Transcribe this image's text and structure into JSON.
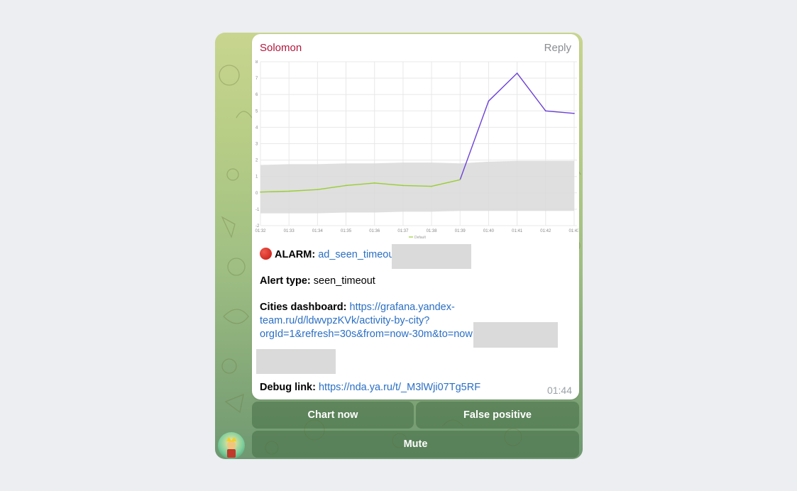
{
  "message": {
    "sender": "Solomon",
    "reply_label": "Reply",
    "alarm_label": "ALARM:",
    "alarm_link": "ad_seen_timeout",
    "alert_type_label": "Alert type:",
    "alert_type_value": "seen_timeout",
    "dashboard_label": "Cities dashboard:",
    "dashboard_link_line1": "https://grafana.yandex-",
    "dashboard_link_line2": "team.ru/d/ldwvpzKVk/activity-by-city?",
    "dashboard_link_line3": "orgId=1&refresh=30s&from=now-30m&to=now",
    "debug_label": "Debug link:",
    "debug_link": "https://nda.ya.ru/t/_M3lWji07Tg5RF",
    "time": "01:44"
  },
  "keyboard": {
    "chart_now": "Chart now",
    "false_positive": "False positive",
    "mute": "Mute"
  },
  "colors": {
    "sender": "#b0163c",
    "link": "#2a6fc4",
    "series_normal": "#9acd32",
    "series_alert": "#6a3fd6",
    "band": "#d9d9d9"
  },
  "chart_data": {
    "type": "line",
    "x": [
      "01:32",
      "01:33",
      "01:34",
      "01:35",
      "01:36",
      "01:37",
      "01:38",
      "01:39",
      "01:40",
      "01:41",
      "01:42",
      "01:43"
    ],
    "series": [
      {
        "values": [
          0.05,
          0.1,
          0.2,
          0.45,
          0.6,
          0.45,
          0.4,
          0.8,
          5.6,
          7.3,
          5.0,
          4.85
        ]
      }
    ],
    "band_upper": [
      1.7,
      1.75,
      1.75,
      1.8,
      1.8,
      1.85,
      1.85,
      1.8,
      1.9,
      1.95,
      1.95,
      1.95
    ],
    "band_lower": [
      -1.25,
      -1.25,
      -1.25,
      -1.2,
      -1.2,
      -1.15,
      -1.15,
      -1.1,
      -1.1,
      -1.1,
      -1.1,
      -1.1
    ],
    "y_ticks": [
      "8",
      "7",
      "6",
      "5",
      "4",
      "3",
      "2",
      "1",
      "0",
      "-1",
      "-2"
    ],
    "ylim": [
      -2,
      8
    ],
    "legend": [
      "Default"
    ],
    "legend_position": "bottom-center",
    "grid": true
  }
}
